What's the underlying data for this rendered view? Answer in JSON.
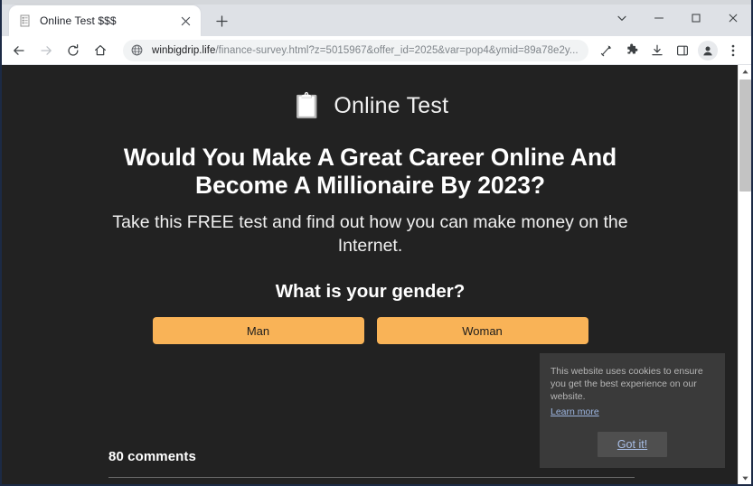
{
  "browser": {
    "tab": {
      "title": "Online Test $$$",
      "favicon": "document-favicon",
      "close_label": "×"
    },
    "new_tab_label": "+",
    "window_controls": {
      "tab_search": "⌄",
      "minimize": "—",
      "maximize": "□",
      "close": "✕"
    },
    "nav": {
      "back": "←",
      "forward": "→",
      "reload": "⟳",
      "home": "⌂"
    },
    "omnibox": {
      "host": "winbigdrip.life",
      "path": "/finance-survey.html?z=5015967&offer_id=2025&var=pop4&ymid=89a78e2y...",
      "site_info_icon": "globe-icon"
    },
    "toolbar_icons": [
      "share-cast-icon",
      "extensions-puzzle-icon",
      "downloads-icon",
      "side-panel-icon",
      "profile-avatar-icon",
      "three-dot-menu-icon"
    ]
  },
  "page": {
    "site_logo_glyph": "📋",
    "site_name": "Online Test",
    "headline": "Would You Make A Great Career Online And Become A Millionaire By 2023?",
    "subheadline": "Take this FREE test and find out how you can make money on the Internet.",
    "question": {
      "title": "What is your gender?",
      "answers": [
        {
          "label": "Man"
        },
        {
          "label": "Woman"
        }
      ]
    },
    "comments": {
      "count_label": "80 comments"
    },
    "cookie_consent": {
      "text": "This website uses cookies to ensure you get the best experience on our website.",
      "learn_more_label": "Learn more",
      "accept_label": "Got it!"
    }
  },
  "colors": {
    "page_background": "#222222",
    "answer_button": "#f9b357",
    "cookie_panel": "#3a3a3a",
    "link_blue": "#9cb5e0",
    "browser_chrome": "#dee1e6"
  },
  "scrollbars": {
    "vertical_up_arrow": "▲",
    "vertical_down_arrow": "▼"
  }
}
